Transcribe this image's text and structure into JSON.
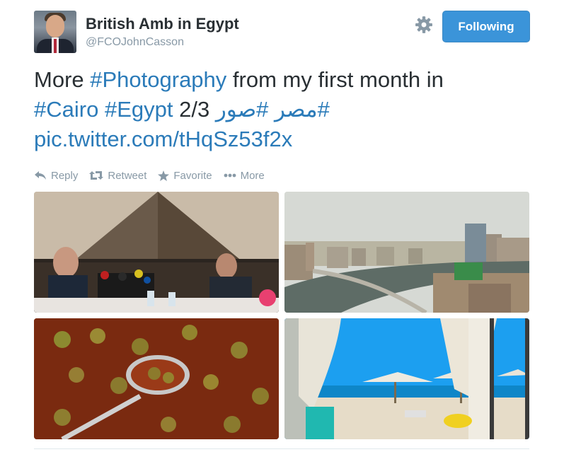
{
  "user": {
    "name": "British Amb in Egypt",
    "handle": "@FCOJohnCasson"
  },
  "follow_button": {
    "label": "Following"
  },
  "tweet": {
    "word_more": "More ",
    "hashtag_photography": "#Photography",
    "mid_text": " from my first month in",
    "hashtag_cairo": "#Cairo",
    "hashtag_egypt": "#Egypt",
    "count_text": "2/3",
    "arabic_hashtags": "#مصر #صور",
    "pic_link": "pic.twitter.com/tHqSz53f2x"
  },
  "actions": {
    "reply": "Reply",
    "retweet": "Retweet",
    "favorite": "Favorite",
    "more": "More"
  },
  "colors": {
    "link": "#2b7bb9",
    "button": "#3b94d9",
    "muted": "#8899a6",
    "text": "#292f33"
  },
  "icons": [
    "gear-icon",
    "reply-icon",
    "retweet-icon",
    "star-icon",
    "more-dots-icon"
  ]
}
